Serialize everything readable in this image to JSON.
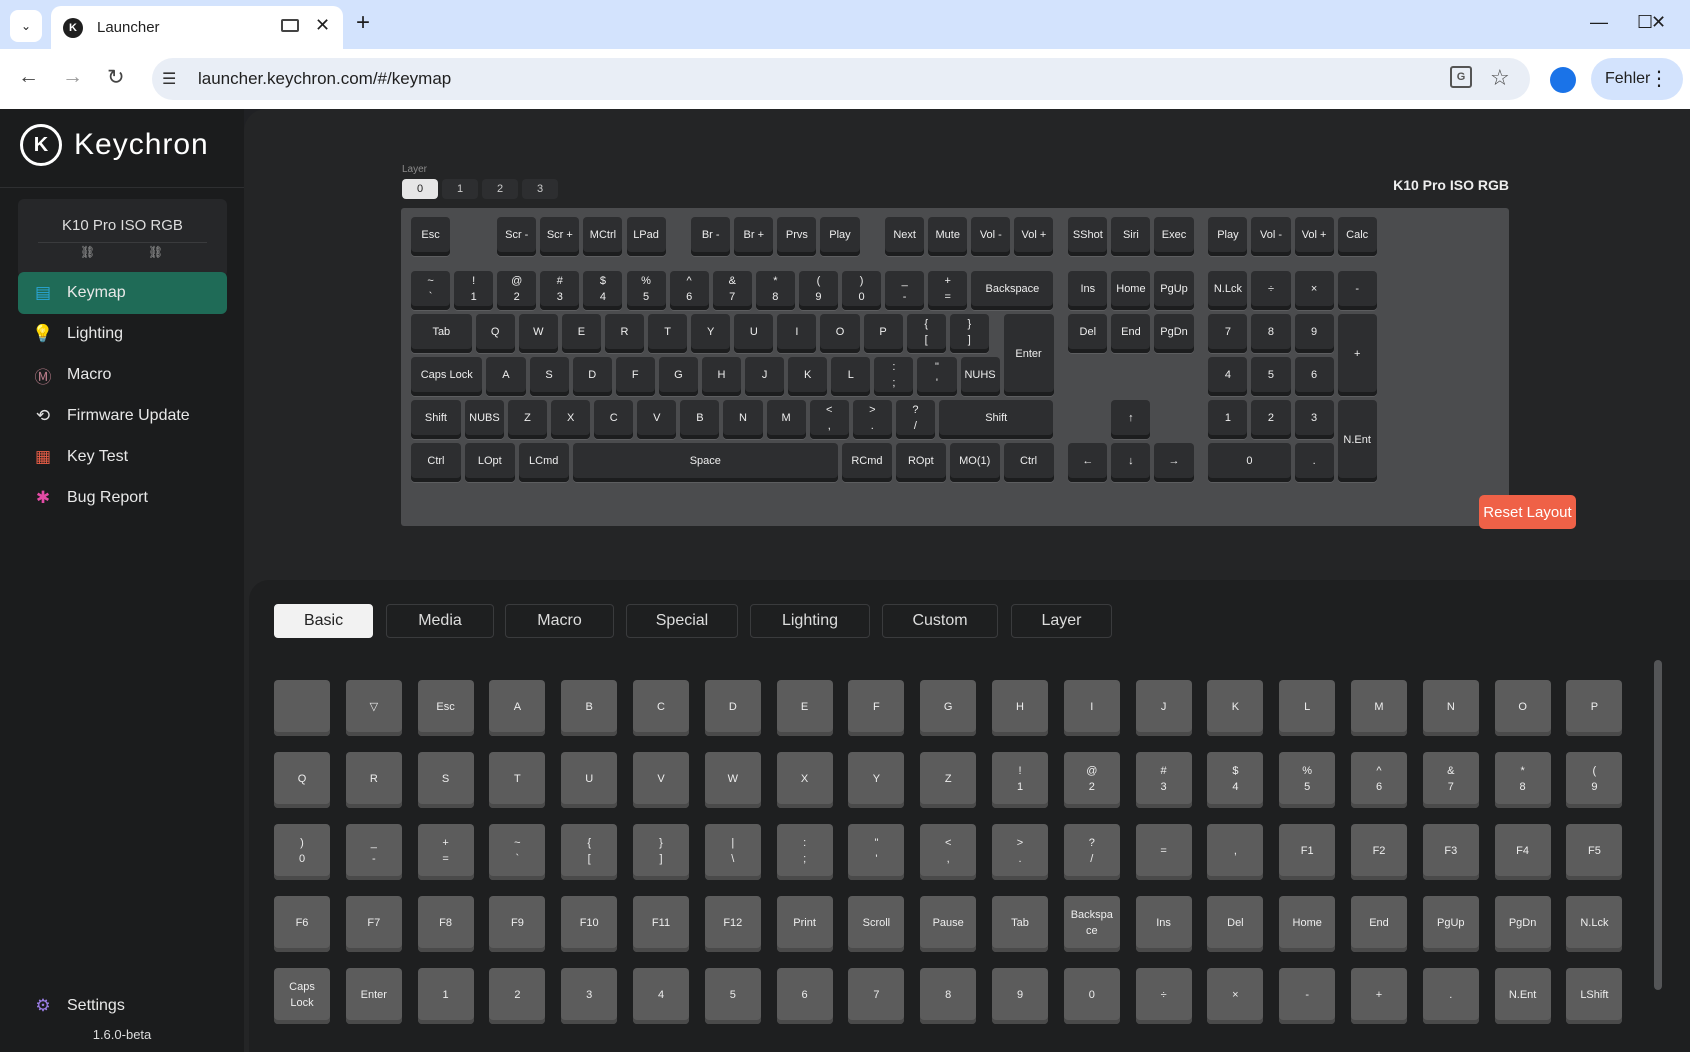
{
  "browser": {
    "tab_title": "Launcher",
    "url": "launcher.keychron.com/#/keymap",
    "profile_button": "Fehler",
    "icons": {
      "favicon": "keychron-logo-icon",
      "media": "media-control-icon",
      "tab_close": "close-icon",
      "new_tab": "plus-icon",
      "back": "back-arrow-icon",
      "forward": "forward-arrow-icon",
      "reload": "reload-icon",
      "site_settings": "tune-icon",
      "translate": "translate-icon",
      "bookmark": "star-icon",
      "profile": "person-icon",
      "menu": "more-vert-icon",
      "tab_dropdown": "chevron-down-icon"
    },
    "glyphs": {
      "tab_dropdown": "⌄",
      "tab_close": "✕",
      "new_tab": "+",
      "minimize": "—",
      "maximize": "☐",
      "close": "✕",
      "back": "←",
      "forward": "→",
      "reload": "↻",
      "tune": "☰",
      "translate": "G",
      "star": "☆",
      "dots": "⋮"
    }
  },
  "app": {
    "brand": "Keychron",
    "logo_letter": "K",
    "device_name": "K10 Pro ISO RGB",
    "link_glyph": "⛓",
    "menu": [
      {
        "label": "Keymap",
        "icon": "keyboard-icon",
        "glyph": "▤",
        "color": "#2aa7d8",
        "active": true
      },
      {
        "label": "Lighting",
        "icon": "bulb-icon",
        "glyph": "💡",
        "color": "#4cc17a",
        "active": false
      },
      {
        "label": "Macro",
        "icon": "macro-icon",
        "glyph": "Ⓜ",
        "color": "#b57a87",
        "active": false
      },
      {
        "label": "Firmware Update",
        "icon": "firmware-update-icon",
        "glyph": "⟲",
        "color": "#e0e0e0",
        "active": false
      },
      {
        "label": "Key Test",
        "icon": "key-test-icon",
        "glyph": "▦",
        "color": "#e65c45",
        "active": false
      },
      {
        "label": "Bug Report",
        "icon": "bug-icon",
        "glyph": "✱",
        "color": "#e34ba5",
        "active": false
      }
    ],
    "settings": {
      "label": "Settings",
      "icon": "gear-icon",
      "glyph": "⚙",
      "color": "#9b7ee6"
    },
    "version": "1.6.0-beta"
  },
  "keymap": {
    "layer_label": "Layer",
    "layers": [
      "0",
      "1",
      "2",
      "3"
    ],
    "selected_layer": "0",
    "keyboard_name": "K10 Pro ISO RGB",
    "reset_label": "Reset Layout",
    "keys": [
      {
        "l": "Esc",
        "x": 0,
        "y": 0,
        "w": 1,
        "h": 1
      },
      {
        "l": "Scr -",
        "x": 2,
        "y": 0,
        "w": 1,
        "h": 1
      },
      {
        "l": "Scr +",
        "x": 3,
        "y": 0,
        "w": 1,
        "h": 1
      },
      {
        "l": "MCtrl",
        "x": 4,
        "y": 0,
        "w": 1,
        "h": 1
      },
      {
        "l": "LPad",
        "x": 5,
        "y": 0,
        "w": 1,
        "h": 1
      },
      {
        "l": "Br -",
        "x": 6.5,
        "y": 0,
        "w": 1,
        "h": 1
      },
      {
        "l": "Br +",
        "x": 7.5,
        "y": 0,
        "w": 1,
        "h": 1
      },
      {
        "l": "Prvs",
        "x": 8.5,
        "y": 0,
        "w": 1,
        "h": 1
      },
      {
        "l": "Play",
        "x": 9.5,
        "y": 0,
        "w": 1,
        "h": 1
      },
      {
        "l": "Next",
        "x": 11,
        "y": 0,
        "w": 1,
        "h": 1
      },
      {
        "l": "Mute",
        "x": 12,
        "y": 0,
        "w": 1,
        "h": 1
      },
      {
        "l": "Vol -",
        "x": 13,
        "y": 0,
        "w": 1,
        "h": 1
      },
      {
        "l": "Vol +",
        "x": 14,
        "y": 0,
        "w": 1,
        "h": 1
      },
      {
        "l": "SShot",
        "x": 15.25,
        "y": 0,
        "w": 1,
        "h": 1
      },
      {
        "l": "Siri",
        "x": 16.25,
        "y": 0,
        "w": 1,
        "h": 1
      },
      {
        "l": "Exec",
        "x": 17.25,
        "y": 0,
        "w": 1,
        "h": 1
      },
      {
        "l": "Play",
        "x": 18.5,
        "y": 0,
        "w": 1,
        "h": 1
      },
      {
        "l": "Vol -",
        "x": 19.5,
        "y": 0,
        "w": 1,
        "h": 1
      },
      {
        "l": "Vol +",
        "x": 20.5,
        "y": 0,
        "w": 1,
        "h": 1
      },
      {
        "l": "Calc",
        "x": 21.5,
        "y": 0,
        "w": 1,
        "h": 1
      },
      {
        "l": "~\n`",
        "x": 0,
        "y": 1.25,
        "w": 1,
        "h": 1
      },
      {
        "l": "!\n1",
        "x": 1,
        "y": 1.25,
        "w": 1,
        "h": 1
      },
      {
        "l": "@\n2",
        "x": 2,
        "y": 1.25,
        "w": 1,
        "h": 1
      },
      {
        "l": "#\n3",
        "x": 3,
        "y": 1.25,
        "w": 1,
        "h": 1
      },
      {
        "l": "$\n4",
        "x": 4,
        "y": 1.25,
        "w": 1,
        "h": 1
      },
      {
        "l": "%\n5",
        "x": 5,
        "y": 1.25,
        "w": 1,
        "h": 1
      },
      {
        "l": "^\n6",
        "x": 6,
        "y": 1.25,
        "w": 1,
        "h": 1
      },
      {
        "l": "&\n7",
        "x": 7,
        "y": 1.25,
        "w": 1,
        "h": 1
      },
      {
        "l": "*\n8",
        "x": 8,
        "y": 1.25,
        "w": 1,
        "h": 1
      },
      {
        "l": "(\n9",
        "x": 9,
        "y": 1.25,
        "w": 1,
        "h": 1
      },
      {
        "l": ")\n0",
        "x": 10,
        "y": 1.25,
        "w": 1,
        "h": 1
      },
      {
        "l": "_\n-",
        "x": 11,
        "y": 1.25,
        "w": 1,
        "h": 1
      },
      {
        "l": "+\n=",
        "x": 12,
        "y": 1.25,
        "w": 1,
        "h": 1
      },
      {
        "l": "Backspace",
        "x": 13,
        "y": 1.25,
        "w": 2,
        "h": 1
      },
      {
        "l": "Ins",
        "x": 15.25,
        "y": 1.25,
        "w": 1,
        "h": 1
      },
      {
        "l": "Home",
        "x": 16.25,
        "y": 1.25,
        "w": 1,
        "h": 1
      },
      {
        "l": "PgUp",
        "x": 17.25,
        "y": 1.25,
        "w": 1,
        "h": 1
      },
      {
        "l": "N.Lck",
        "x": 18.5,
        "y": 1.25,
        "w": 1,
        "h": 1
      },
      {
        "l": "÷",
        "x": 19.5,
        "y": 1.25,
        "w": 1,
        "h": 1
      },
      {
        "l": "×",
        "x": 20.5,
        "y": 1.25,
        "w": 1,
        "h": 1
      },
      {
        "l": "-",
        "x": 21.5,
        "y": 1.25,
        "w": 1,
        "h": 1
      },
      {
        "l": "Tab",
        "x": 0,
        "y": 2.25,
        "w": 1.5,
        "h": 1
      },
      {
        "l": "Q",
        "x": 1.5,
        "y": 2.25,
        "w": 1,
        "h": 1
      },
      {
        "l": "W",
        "x": 2.5,
        "y": 2.25,
        "w": 1,
        "h": 1
      },
      {
        "l": "E",
        "x": 3.5,
        "y": 2.25,
        "w": 1,
        "h": 1
      },
      {
        "l": "R",
        "x": 4.5,
        "y": 2.25,
        "w": 1,
        "h": 1
      },
      {
        "l": "T",
        "x": 5.5,
        "y": 2.25,
        "w": 1,
        "h": 1
      },
      {
        "l": "Y",
        "x": 6.5,
        "y": 2.25,
        "w": 1,
        "h": 1
      },
      {
        "l": "U",
        "x": 7.5,
        "y": 2.25,
        "w": 1,
        "h": 1
      },
      {
        "l": "I",
        "x": 8.5,
        "y": 2.25,
        "w": 1,
        "h": 1
      },
      {
        "l": "O",
        "x": 9.5,
        "y": 2.25,
        "w": 1,
        "h": 1
      },
      {
        "l": "P",
        "x": 10.5,
        "y": 2.25,
        "w": 1,
        "h": 1
      },
      {
        "l": "{\n[",
        "x": 11.5,
        "y": 2.25,
        "w": 1,
        "h": 1
      },
      {
        "l": "}\n]",
        "x": 12.5,
        "y": 2.25,
        "w": 1,
        "h": 1
      },
      {
        "l": "Enter",
        "x": 13.75,
        "y": 2.25,
        "w": 1.25,
        "h": 2
      },
      {
        "l": "Del",
        "x": 15.25,
        "y": 2.25,
        "w": 1,
        "h": 1
      },
      {
        "l": "End",
        "x": 16.25,
        "y": 2.25,
        "w": 1,
        "h": 1
      },
      {
        "l": "PgDn",
        "x": 17.25,
        "y": 2.25,
        "w": 1,
        "h": 1
      },
      {
        "l": "7",
        "x": 18.5,
        "y": 2.25,
        "w": 1,
        "h": 1
      },
      {
        "l": "8",
        "x": 19.5,
        "y": 2.25,
        "w": 1,
        "h": 1
      },
      {
        "l": "9",
        "x": 20.5,
        "y": 2.25,
        "w": 1,
        "h": 1
      },
      {
        "l": "+",
        "x": 21.5,
        "y": 2.25,
        "w": 1,
        "h": 2
      },
      {
        "l": "Caps Lock",
        "x": 0,
        "y": 3.25,
        "w": 1.75,
        "h": 1
      },
      {
        "l": "A",
        "x": 1.75,
        "y": 3.25,
        "w": 1,
        "h": 1
      },
      {
        "l": "S",
        "x": 2.75,
        "y": 3.25,
        "w": 1,
        "h": 1
      },
      {
        "l": "D",
        "x": 3.75,
        "y": 3.25,
        "w": 1,
        "h": 1
      },
      {
        "l": "F",
        "x": 4.75,
        "y": 3.25,
        "w": 1,
        "h": 1
      },
      {
        "l": "G",
        "x": 5.75,
        "y": 3.25,
        "w": 1,
        "h": 1
      },
      {
        "l": "H",
        "x": 6.75,
        "y": 3.25,
        "w": 1,
        "h": 1
      },
      {
        "l": "J",
        "x": 7.75,
        "y": 3.25,
        "w": 1,
        "h": 1
      },
      {
        "l": "K",
        "x": 8.75,
        "y": 3.25,
        "w": 1,
        "h": 1
      },
      {
        "l": "L",
        "x": 9.75,
        "y": 3.25,
        "w": 1,
        "h": 1
      },
      {
        "l": ":\n;",
        "x": 10.75,
        "y": 3.25,
        "w": 1,
        "h": 1
      },
      {
        "l": "\"\n'",
        "x": 11.75,
        "y": 3.25,
        "w": 1,
        "h": 1
      },
      {
        "l": "NUHS",
        "x": 12.75,
        "y": 3.25,
        "w": 1,
        "h": 1
      },
      {
        "l": "4",
        "x": 18.5,
        "y": 3.25,
        "w": 1,
        "h": 1
      },
      {
        "l": "5",
        "x": 19.5,
        "y": 3.25,
        "w": 1,
        "h": 1
      },
      {
        "l": "6",
        "x": 20.5,
        "y": 3.25,
        "w": 1,
        "h": 1
      },
      {
        "l": "Shift",
        "x": 0,
        "y": 4.25,
        "w": 1.25,
        "h": 1
      },
      {
        "l": "NUBS",
        "x": 1.25,
        "y": 4.25,
        "w": 1,
        "h": 1
      },
      {
        "l": "Z",
        "x": 2.25,
        "y": 4.25,
        "w": 1,
        "h": 1
      },
      {
        "l": "X",
        "x": 3.25,
        "y": 4.25,
        "w": 1,
        "h": 1
      },
      {
        "l": "C",
        "x": 4.25,
        "y": 4.25,
        "w": 1,
        "h": 1
      },
      {
        "l": "V",
        "x": 5.25,
        "y": 4.25,
        "w": 1,
        "h": 1
      },
      {
        "l": "B",
        "x": 6.25,
        "y": 4.25,
        "w": 1,
        "h": 1
      },
      {
        "l": "N",
        "x": 7.25,
        "y": 4.25,
        "w": 1,
        "h": 1
      },
      {
        "l": "M",
        "x": 8.25,
        "y": 4.25,
        "w": 1,
        "h": 1
      },
      {
        "l": "<\n,",
        "x": 9.25,
        "y": 4.25,
        "w": 1,
        "h": 1
      },
      {
        "l": ">\n.",
        "x": 10.25,
        "y": 4.25,
        "w": 1,
        "h": 1
      },
      {
        "l": "?\n/",
        "x": 11.25,
        "y": 4.25,
        "w": 1,
        "h": 1
      },
      {
        "l": "Shift",
        "x": 12.25,
        "y": 4.25,
        "w": 2.75,
        "h": 1
      },
      {
        "l": "↑",
        "x": 16.25,
        "y": 4.25,
        "w": 1,
        "h": 1
      },
      {
        "l": "1",
        "x": 18.5,
        "y": 4.25,
        "w": 1,
        "h": 1
      },
      {
        "l": "2",
        "x": 19.5,
        "y": 4.25,
        "w": 1,
        "h": 1
      },
      {
        "l": "3",
        "x": 20.5,
        "y": 4.25,
        "w": 1,
        "h": 1
      },
      {
        "l": "N.Ent",
        "x": 21.5,
        "y": 4.25,
        "w": 1,
        "h": 2
      },
      {
        "l": "Ctrl",
        "x": 0,
        "y": 5.25,
        "w": 1.25,
        "h": 1
      },
      {
        "l": "LOpt",
        "x": 1.25,
        "y": 5.25,
        "w": 1.25,
        "h": 1
      },
      {
        "l": "LCmd",
        "x": 2.5,
        "y": 5.25,
        "w": 1.25,
        "h": 1
      },
      {
        "l": "Space",
        "x": 3.75,
        "y": 5.25,
        "w": 6.25,
        "h": 1
      },
      {
        "l": "RCmd",
        "x": 10,
        "y": 5.25,
        "w": 1.25,
        "h": 1
      },
      {
        "l": "ROpt",
        "x": 11.25,
        "y": 5.25,
        "w": 1.25,
        "h": 1
      },
      {
        "l": "MO(1)",
        "x": 12.5,
        "y": 5.25,
        "w": 1.25,
        "h": 1
      },
      {
        "l": "Ctrl",
        "x": 13.75,
        "y": 5.25,
        "w": 1.25,
        "h": 1
      },
      {
        "l": "←",
        "x": 15.25,
        "y": 5.25,
        "w": 1,
        "h": 1
      },
      {
        "l": "↓",
        "x": 16.25,
        "y": 5.25,
        "w": 1,
        "h": 1
      },
      {
        "l": "→",
        "x": 17.25,
        "y": 5.25,
        "w": 1,
        "h": 1
      },
      {
        "l": "0",
        "x": 18.5,
        "y": 5.25,
        "w": 2,
        "h": 1
      },
      {
        "l": ".",
        "x": 20.5,
        "y": 5.25,
        "w": 1,
        "h": 1
      }
    ]
  },
  "palette": {
    "tabs": [
      {
        "label": "Basic",
        "selected": true
      },
      {
        "label": "Media",
        "selected": false
      },
      {
        "label": "Macro",
        "selected": false
      },
      {
        "label": "Special",
        "selected": false
      },
      {
        "label": "Lighting",
        "selected": false
      },
      {
        "label": "Custom",
        "selected": false
      },
      {
        "label": "Layer",
        "selected": false
      }
    ],
    "keys": [
      "",
      "▽",
      "Esc",
      "A",
      "B",
      "C",
      "D",
      "E",
      "F",
      "G",
      "H",
      "I",
      "J",
      "K",
      "L",
      "M",
      "N",
      "O",
      "P",
      "Q",
      "R",
      "S",
      "T",
      "U",
      "V",
      "W",
      "X",
      "Y",
      "Z",
      "!\n1",
      "@\n2",
      "#\n3",
      "$\n4",
      "%\n5",
      "^\n6",
      "&\n7",
      "*\n8",
      "(\n9",
      ")\n0",
      "_\n-",
      "+\n=",
      "~\n`",
      "{\n[",
      "}\n]",
      "|\n\\",
      ":\n;",
      "\"\n'",
      "<\n,",
      ">\n.",
      "?\n/",
      "=",
      ",",
      "F1",
      "F2",
      "F3",
      "F4",
      "F5",
      "F6",
      "F7",
      "F8",
      "F9",
      "F10",
      "F11",
      "F12",
      "Print",
      "Scroll",
      "Pause",
      "Tab",
      "Backspa\nce",
      "Ins",
      "Del",
      "Home",
      "End",
      "PgUp",
      "PgDn",
      "N.Lck",
      "Caps\nLock",
      "Enter",
      "1",
      "2",
      "3",
      "4",
      "5",
      "6",
      "7",
      "8",
      "9",
      "0",
      "÷",
      "×",
      "-",
      "+",
      ".",
      "N.Ent",
      "LShift"
    ]
  }
}
